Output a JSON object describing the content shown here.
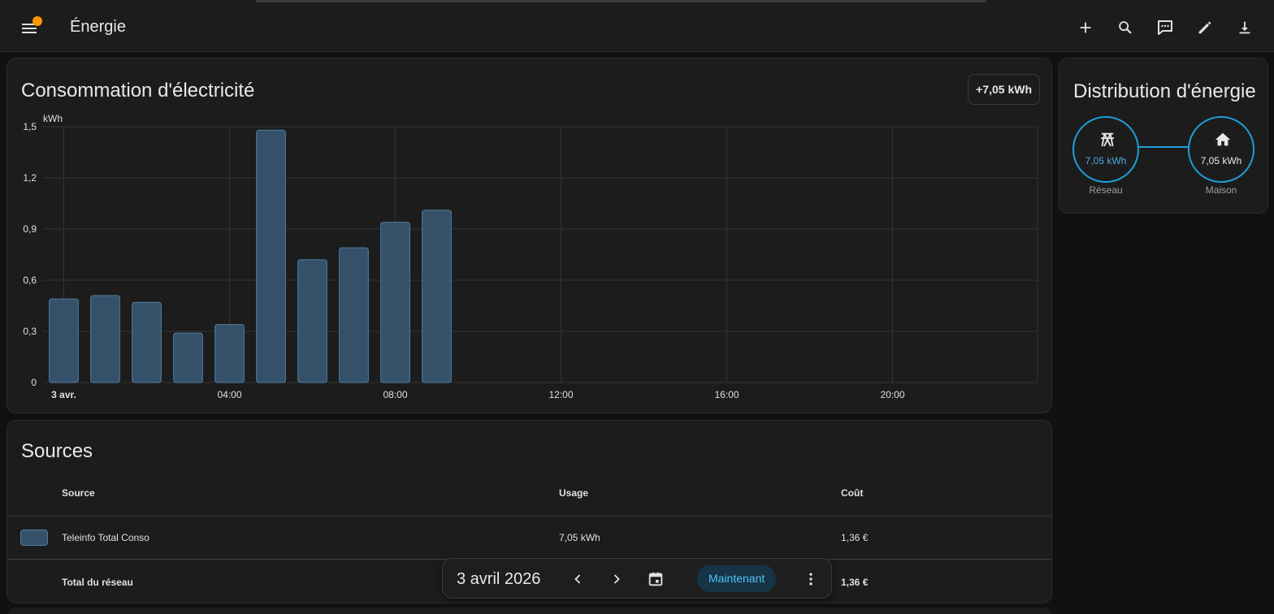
{
  "header": {
    "title": "Énergie",
    "actions": [
      {
        "name": "add-icon",
        "label": "+"
      },
      {
        "name": "search-icon",
        "label": "search"
      },
      {
        "name": "assist-icon",
        "label": "assist"
      },
      {
        "name": "edit-icon",
        "label": "edit"
      },
      {
        "name": "download-icon",
        "label": "download"
      }
    ]
  },
  "consumption_card": {
    "title": "Consommation d'électricité",
    "total": "+7,05 kWh"
  },
  "chart_data": {
    "type": "bar",
    "unit_label": "kWh",
    "x_tick_labels": [
      "3 avr.",
      "04:00",
      "08:00",
      "12:00",
      "16:00",
      "20:00"
    ],
    "y_tick_labels": [
      "0",
      "0,3",
      "0,6",
      "0,9",
      "1,2",
      "1,5"
    ],
    "ylim": [
      0,
      1.5
    ],
    "x_hours": [
      0,
      1,
      2,
      3,
      4,
      5,
      6,
      7,
      8,
      9
    ],
    "values": [
      0.49,
      0.51,
      0.47,
      0.29,
      0.34,
      1.48,
      0.72,
      0.79,
      0.94,
      1.01
    ],
    "series": [
      {
        "color": "#35516a"
      }
    ],
    "grid": true
  },
  "distribution_card": {
    "title": "Distribution d'énergie",
    "grid_node": {
      "value": "7,05 kWh",
      "label": "Réseau",
      "icon": "transmission-tower-icon"
    },
    "home_node": {
      "value": "7,05 kWh",
      "label": "Maison",
      "icon": "home-icon"
    }
  },
  "sources_card": {
    "title": "Sources",
    "columns": [
      "Source",
      "Usage",
      "Coût"
    ],
    "rows": [
      {
        "source": "Teleinfo Total Conso",
        "usage": "7,05 kWh",
        "cost": "1,36 €",
        "color": "#35516a"
      }
    ],
    "total": {
      "label": "Total du réseau",
      "cost": "1,36 €"
    }
  },
  "date_picker": {
    "date": "3 avril 2026",
    "now_label": "Maintenant"
  },
  "colors": {
    "accent": "#1e9fd8",
    "bar_fill": "#35516a",
    "bar_stroke": "#4f7ea2",
    "badge": "#ff9800"
  }
}
